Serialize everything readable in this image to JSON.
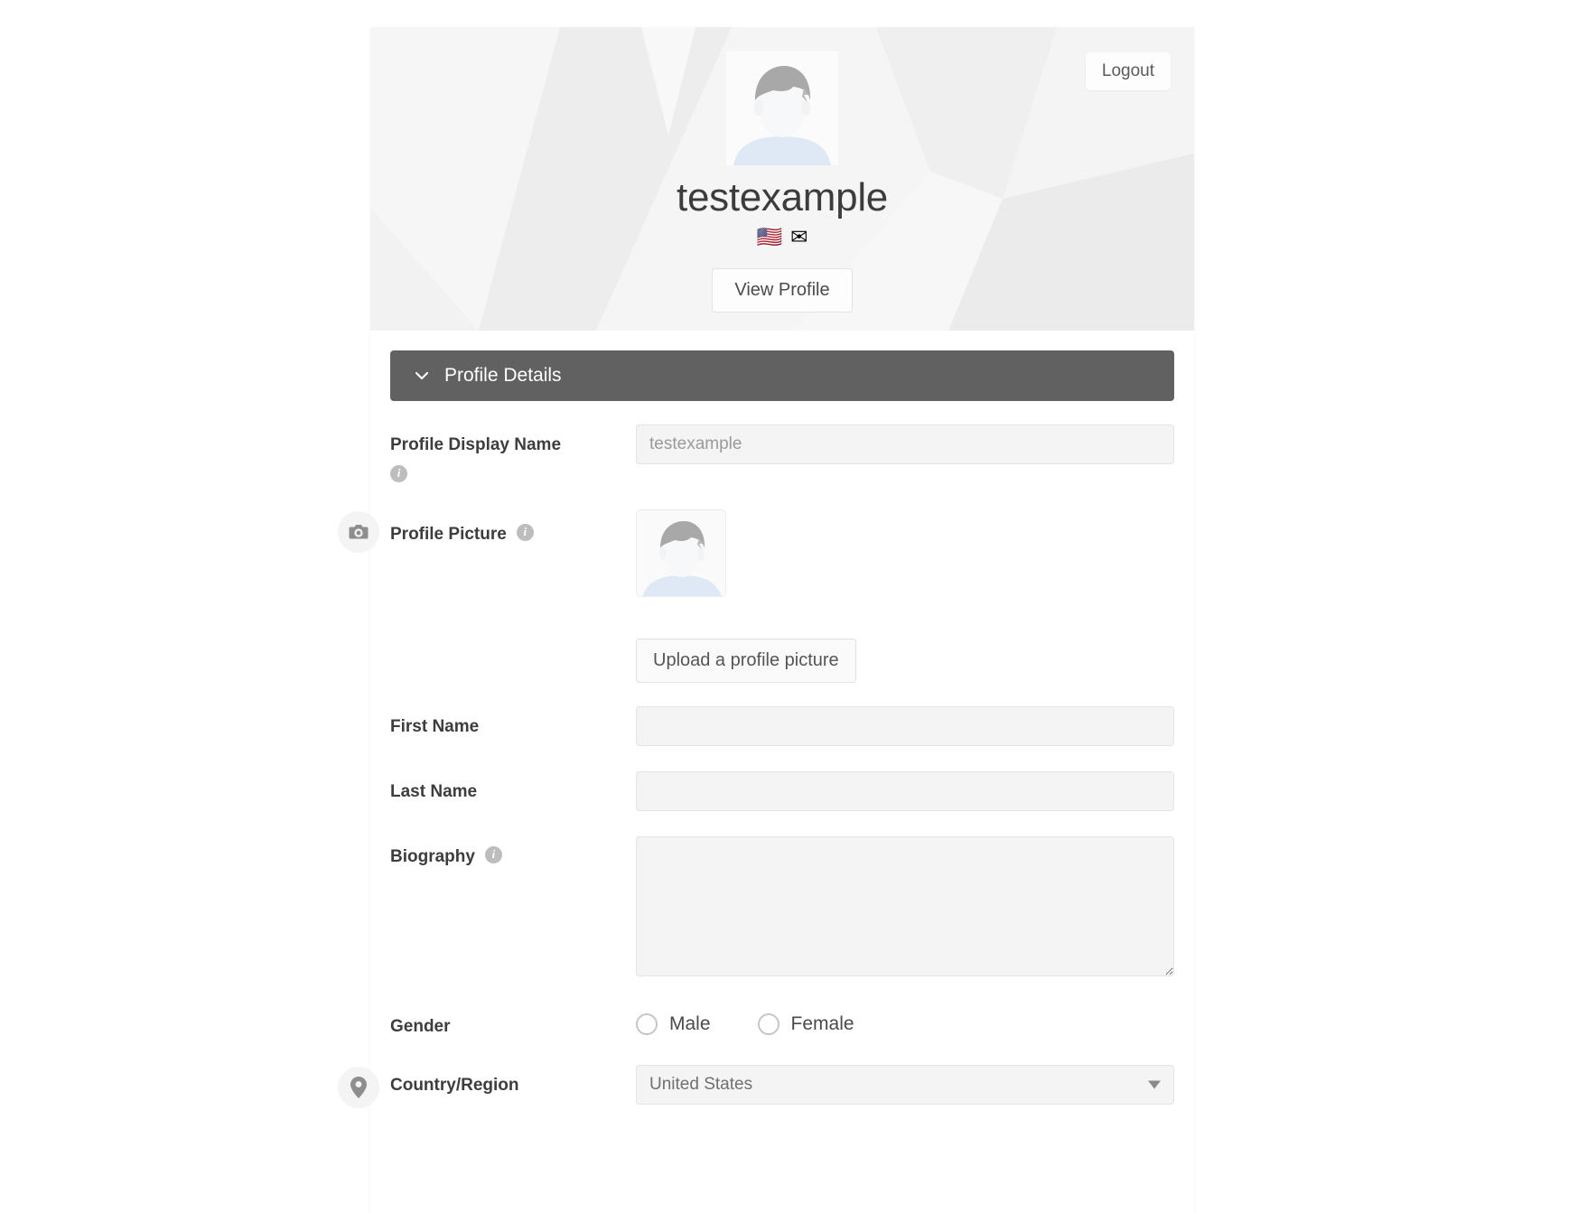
{
  "header": {
    "logout_label": "Logout",
    "username": "testexample",
    "view_profile_label": "View Profile",
    "avatar_icon": "user-avatar-placeholder",
    "badges": [
      {
        "icon": "us-flag-icon",
        "glyph": "🇺🇸"
      },
      {
        "icon": "envelope-icon",
        "glyph": "✉"
      }
    ]
  },
  "section": {
    "title": "Profile Details",
    "chevron_icon": "chevron-down-icon",
    "expanded": true
  },
  "fields": {
    "display_name": {
      "label": "Profile Display Name",
      "value": "",
      "placeholder": "testexample",
      "info_icon": "info-icon"
    },
    "profile_picture": {
      "label": "Profile Picture",
      "lead_icon": "camera-icon",
      "info_icon": "info-icon",
      "thumb_icon": "user-avatar-placeholder",
      "upload_label": "Upload a profile picture"
    },
    "first_name": {
      "label": "First Name",
      "value": "",
      "placeholder": ""
    },
    "last_name": {
      "label": "Last Name",
      "value": "",
      "placeholder": ""
    },
    "biography": {
      "label": "Biography",
      "value": "",
      "placeholder": "",
      "info_icon": "info-icon"
    },
    "gender": {
      "label": "Gender",
      "selected": "",
      "options": [
        {
          "label": "Male",
          "value": "male",
          "checked": false
        },
        {
          "label": "Female",
          "value": "female",
          "checked": false
        }
      ]
    },
    "country": {
      "label": "Country/Region",
      "lead_icon": "location-pin-icon",
      "value": "United States",
      "options": [
        "United States"
      ],
      "arrow_icon": "caret-down-icon"
    }
  },
  "colors": {
    "section_header_bg": "#616161",
    "page_bg": "#ffffff",
    "banner_bg": "#f2f2f2",
    "input_bg": "#f4f4f4",
    "label_text": "#3d3d3d"
  }
}
